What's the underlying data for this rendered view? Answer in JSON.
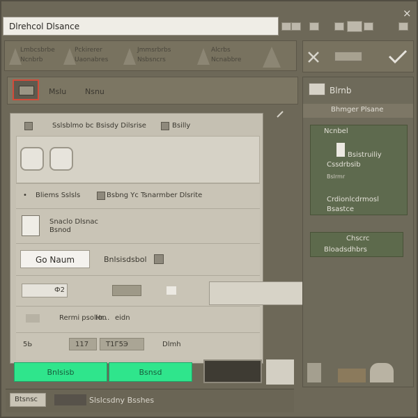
{
  "window": {
    "title": "Dlrehcol Dlsance",
    "close_glyph": "×"
  },
  "header_items": [
    "Lmbcsbrbe",
    "Pckirerer",
    "Jmmsrbrbs",
    "Alcrbs"
  ],
  "header_subs": [
    "Ncnbrb",
    "Uaonabres",
    "Nsbsncrs",
    "Ncnabbre"
  ],
  "menu": {
    "item1": "Mslu",
    "item2": "Nsnu"
  },
  "panel": {
    "row1_label": "Sslsblmo bc Bsisdy Dilsrise",
    "row1_extra": "Bsilly",
    "row3_label": "Bliems Sslsls",
    "row3_label2": "Bsbng Yc Tsnarmber Dlsrite",
    "row4_label1": "Snaclo Dlsnac",
    "row4_label2": "Bsnod",
    "go_button": "Go Naum",
    "wizard_label": "Bnlsisdsbol",
    "field1_value": "Ф2",
    "row6_label": "Rermi psolion",
    "row6_value": "Hr...",
    "row6_value2": "eidn",
    "row7_a": "5Ь",
    "row7_b": "117",
    "row7_c": "T1Г5Э",
    "row7_d": "Dlmh"
  },
  "green_buttons": [
    "Bnlsisb",
    "Bsnsd"
  ],
  "right": {
    "title": "Blrnb",
    "subtitle": "Bhmger Plsane",
    "card1_label": "Ncnbel",
    "card1_line1": "Bsistruiliy",
    "card1_line2": "Cssdrbsib",
    "card1_line3": "Bslrmr",
    "card1_line4": "Crdionlcdrmosl",
    "card1_line5": "Bsastce",
    "card2_line1": "Chscrc",
    "card2_line2": "Bloadsdhbrs"
  },
  "bottom": {
    "field_value": "Btsnsc",
    "label": "Slslcsdny Bsshes"
  },
  "colors": {
    "accent_green": "#2fe58c",
    "highlight_red": "#d24b3a"
  },
  "icons": [
    "close-icon",
    "confirm-check-icon",
    "cancel-x-icon",
    "toggle-icon"
  ]
}
